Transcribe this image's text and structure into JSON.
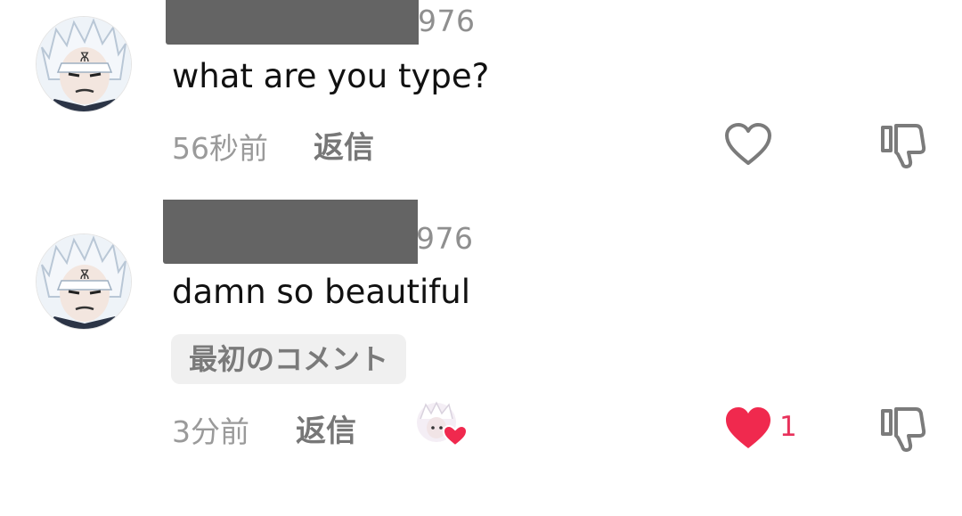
{
  "comments": [
    {
      "username_suffix": "976",
      "text": "what are you type?",
      "time": "56秒前",
      "reply_label": "返信",
      "liked": false,
      "like_count": "",
      "badge": ""
    },
    {
      "username_suffix": "976",
      "text": "damn so beautiful",
      "time": "3分前",
      "reply_label": "返信",
      "liked": true,
      "like_count": "1",
      "badge": "最初のコメント"
    }
  ],
  "colors": {
    "like_red": "#f0294e",
    "icon_gray": "#7b7b7b",
    "redaction": "#646464"
  },
  "icons": [
    "heart-outline-icon",
    "thumbs-down-icon",
    "heart-filled-icon",
    "creator-liked-avatar"
  ]
}
